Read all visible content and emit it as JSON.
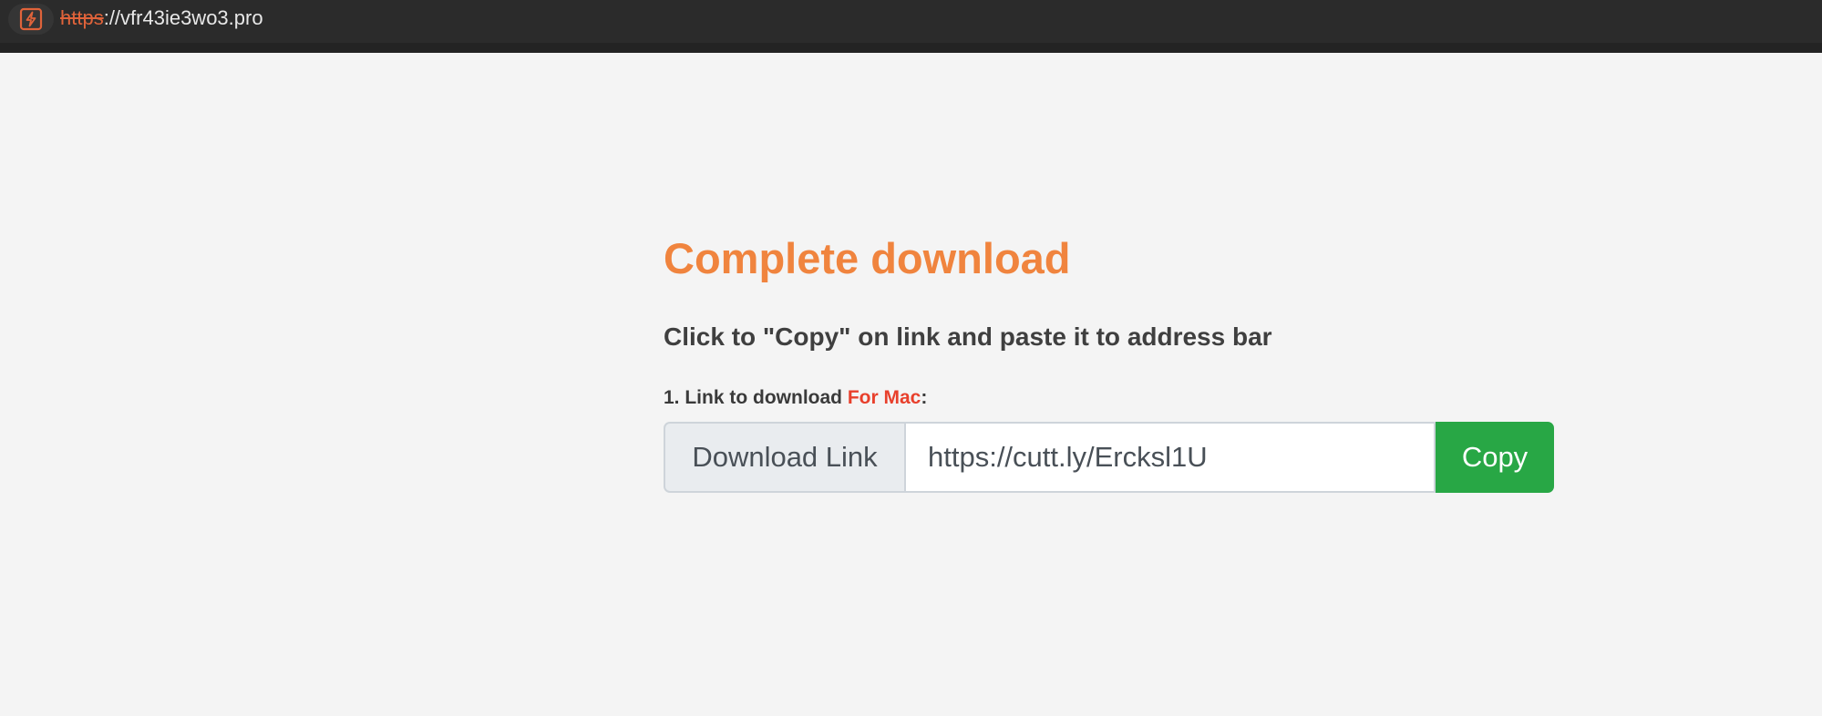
{
  "browser": {
    "url_scheme": "https",
    "url_rest": "://vfr43ie3wo3.pro",
    "security_icon": "not-secure-icon"
  },
  "page": {
    "title": "Complete download",
    "instruction": "Click to \"Copy\" on link and paste it to address bar",
    "link_label_prefix": "1. Link to download ",
    "link_label_platform": "For Mac",
    "link_label_suffix": ":",
    "addon_label": "Download Link",
    "link_value": "https://cutt.ly/Ercksl1U",
    "copy_label": "Copy"
  },
  "colors": {
    "title": "#f0843e",
    "platform_highlight": "#e8402c",
    "copy_button": "#28a745",
    "insecure_scheme": "#e0633a"
  }
}
